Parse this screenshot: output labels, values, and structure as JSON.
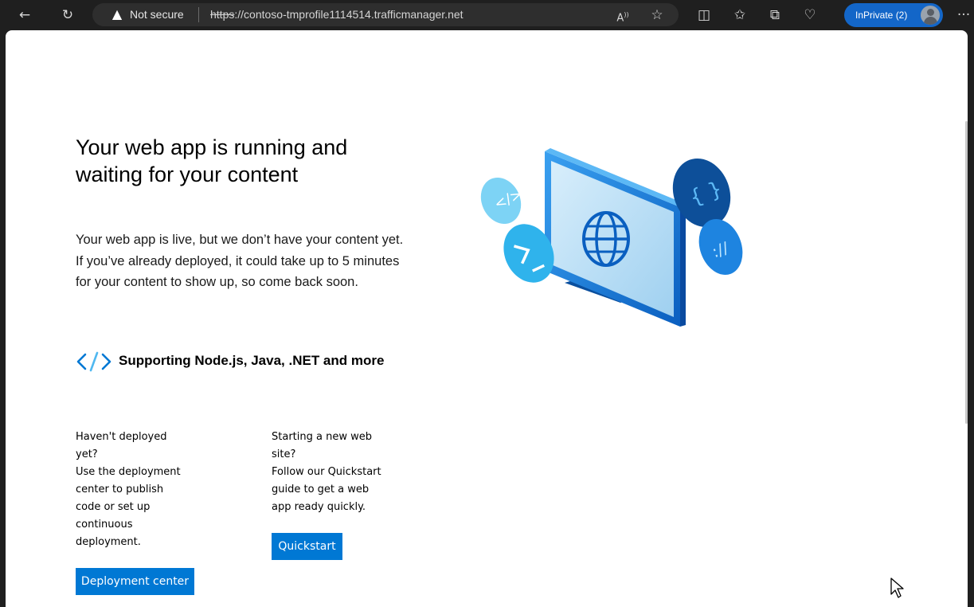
{
  "browser": {
    "security_label": "Not secure",
    "url_scheme": "https",
    "url_rest": "://contoso-tmprofile1114514.trafficmanager.net",
    "inprivate_label": "InPrivate (2)",
    "icons": [
      "back-icon",
      "refresh-icon",
      "warning-icon",
      "read-aloud-icon",
      "favorite-star-icon",
      "split-screen-icon",
      "favorites-icon",
      "collections-icon",
      "browser-essentials-icon",
      "more-icon"
    ]
  },
  "content": {
    "headline_line1": "Your web app is running and",
    "headline_line2": "waiting for your content",
    "para_line1": "Your web app is live, but we don’t have your content yet.",
    "para_line2": "If you’ve already deployed, it could take up to 5 minutes",
    "para_line3": "for your content to show up, so come back soon.",
    "support_text": "Supporting Node.js, Java, .NET and more",
    "deploy": {
      "lines": [
        "Haven't deployed",
        "yet?",
        "Use the deployment",
        "center to publish",
        "code or set up",
        "continuous",
        "deployment."
      ],
      "button_label": "Deployment center"
    },
    "quickstart": {
      "lines": [
        "Starting a new web",
        "site?",
        "Follow our Quickstart",
        "guide to get a web",
        "app ready quickly."
      ],
      "button_label": "Quickstart"
    }
  },
  "colors": {
    "accent": "#0078d4",
    "inprivate": "#1366c8",
    "toolbar": "#1f1f1f"
  }
}
